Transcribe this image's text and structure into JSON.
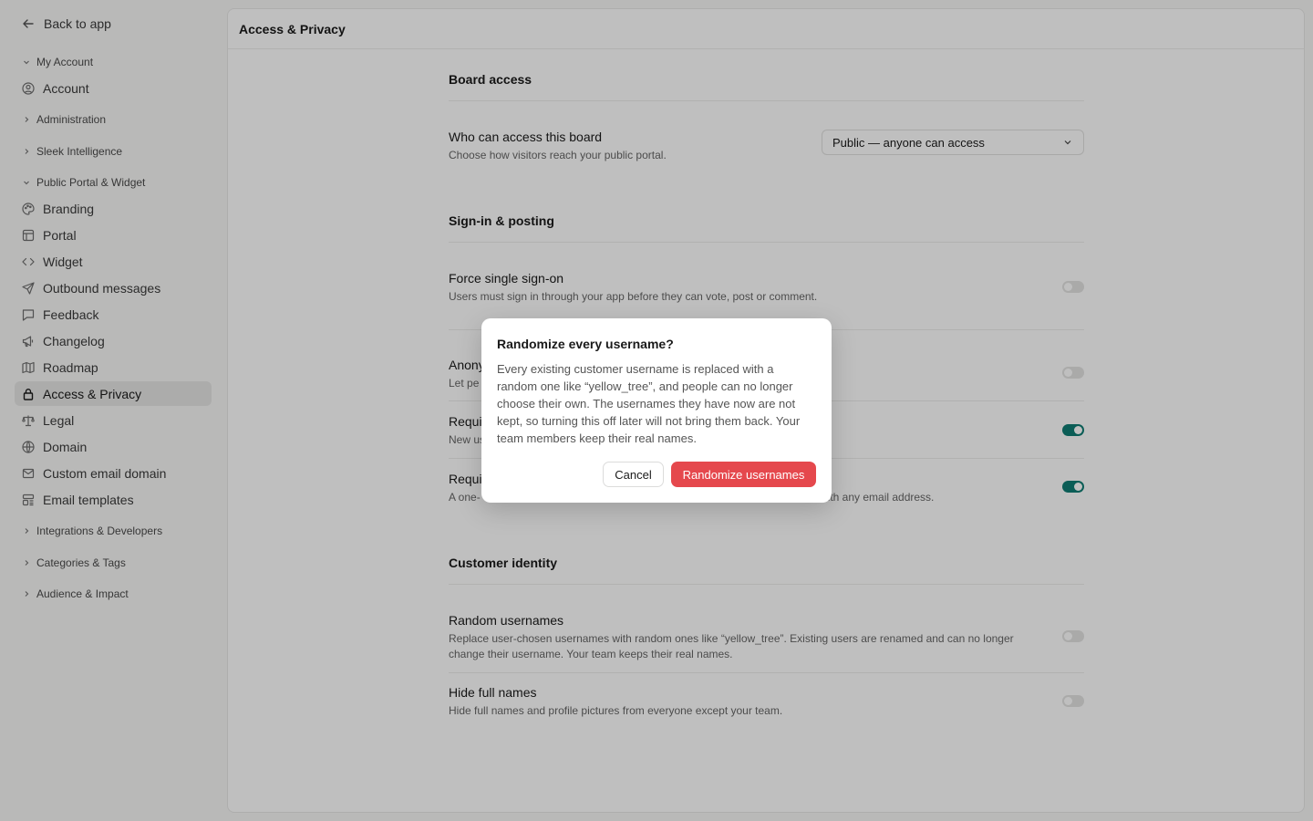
{
  "sidebar": {
    "back_label": "Back to app",
    "sections": {
      "my_account": "My Account",
      "administration": "Administration",
      "sleek_intelligence": "Sleek Intelligence",
      "public_portal": "Public Portal & Widget",
      "integrations": "Integrations & Developers",
      "categories": "Categories & Tags",
      "audience": "Audience & Impact"
    },
    "items": {
      "account": "Account",
      "branding": "Branding",
      "portal": "Portal",
      "widget": "Widget",
      "outbound": "Outbound messages",
      "feedback": "Feedback",
      "changelog": "Changelog",
      "roadmap": "Roadmap",
      "access": "Access & Privacy",
      "legal": "Legal",
      "domain": "Domain",
      "custom_email": "Custom email domain",
      "email_templates": "Email templates"
    }
  },
  "page": {
    "title": "Access & Privacy",
    "board_access": {
      "heading": "Board access",
      "who_title": "Who can access this board",
      "who_desc": "Choose how visitors reach your public portal.",
      "select_value": "Public — anyone can access"
    },
    "signin": {
      "heading": "Sign-in & posting",
      "sso_title": "Force single sign-on",
      "sso_desc": "Users must sign in through your app before they can vote, post or comment.",
      "anon_title": "Anony",
      "anon_desc": "Let pe",
      "req1_title": "Requi",
      "req1_desc": "New us",
      "req2_title": "Requi",
      "req2_desc": "A one-",
      "req2_desc_tail": "with any email address."
    },
    "identity": {
      "heading": "Customer identity",
      "random_title": "Random usernames",
      "random_desc_1": "Replace user-chosen usernames with random ones like “yellow_tree”. Existing users are renamed and can no longer",
      "random_desc_2": "change their username. Your team keeps their real names.",
      "hide_title": "Hide full names",
      "hide_desc": "Hide full names and profile pictures from everyone except your team."
    },
    "toggles": {
      "sso": false,
      "anon": false,
      "req1": true,
      "req2": true,
      "random": false,
      "hide": false
    }
  },
  "modal": {
    "title": "Randomize every username?",
    "body": "Every existing customer username is replaced with a random one like “yellow_tree”, and people can no longer choose their own. The usernames they have now are not kept, so turning this off later will not bring them back. Your team members keep their real names.",
    "cancel_label": "Cancel",
    "confirm_label": "Randomize usernames"
  },
  "colors": {
    "toggle_on": "#0f7d73",
    "danger": "#e5484d"
  }
}
